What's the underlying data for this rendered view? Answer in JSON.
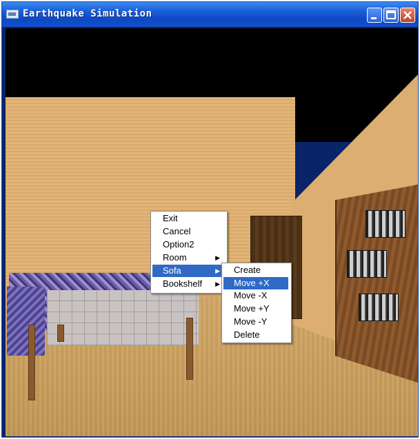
{
  "window": {
    "title": "Earthquake Simulation",
    "controls": [
      "minimize-icon",
      "maximize-icon",
      "close-icon"
    ]
  },
  "context_menu": {
    "items": [
      {
        "label": "Exit",
        "has_submenu": false
      },
      {
        "label": "Cancel",
        "has_submenu": false
      },
      {
        "label": "Option2",
        "has_submenu": false
      },
      {
        "label": "Room",
        "has_submenu": true
      },
      {
        "label": "Sofa",
        "has_submenu": true,
        "highlighted": true
      },
      {
        "label": "Bookshelf",
        "has_submenu": true
      }
    ]
  },
  "submenu": {
    "items": [
      {
        "label": "Create"
      },
      {
        "label": "Move +X",
        "highlighted": true
      },
      {
        "label": "Move -X"
      },
      {
        "label": "Move +Y"
      },
      {
        "label": "Move -Y"
      },
      {
        "label": "Delete"
      }
    ]
  },
  "colors": {
    "titlebar": "#1c5fd9",
    "menu_highlight": "#316ac5"
  }
}
